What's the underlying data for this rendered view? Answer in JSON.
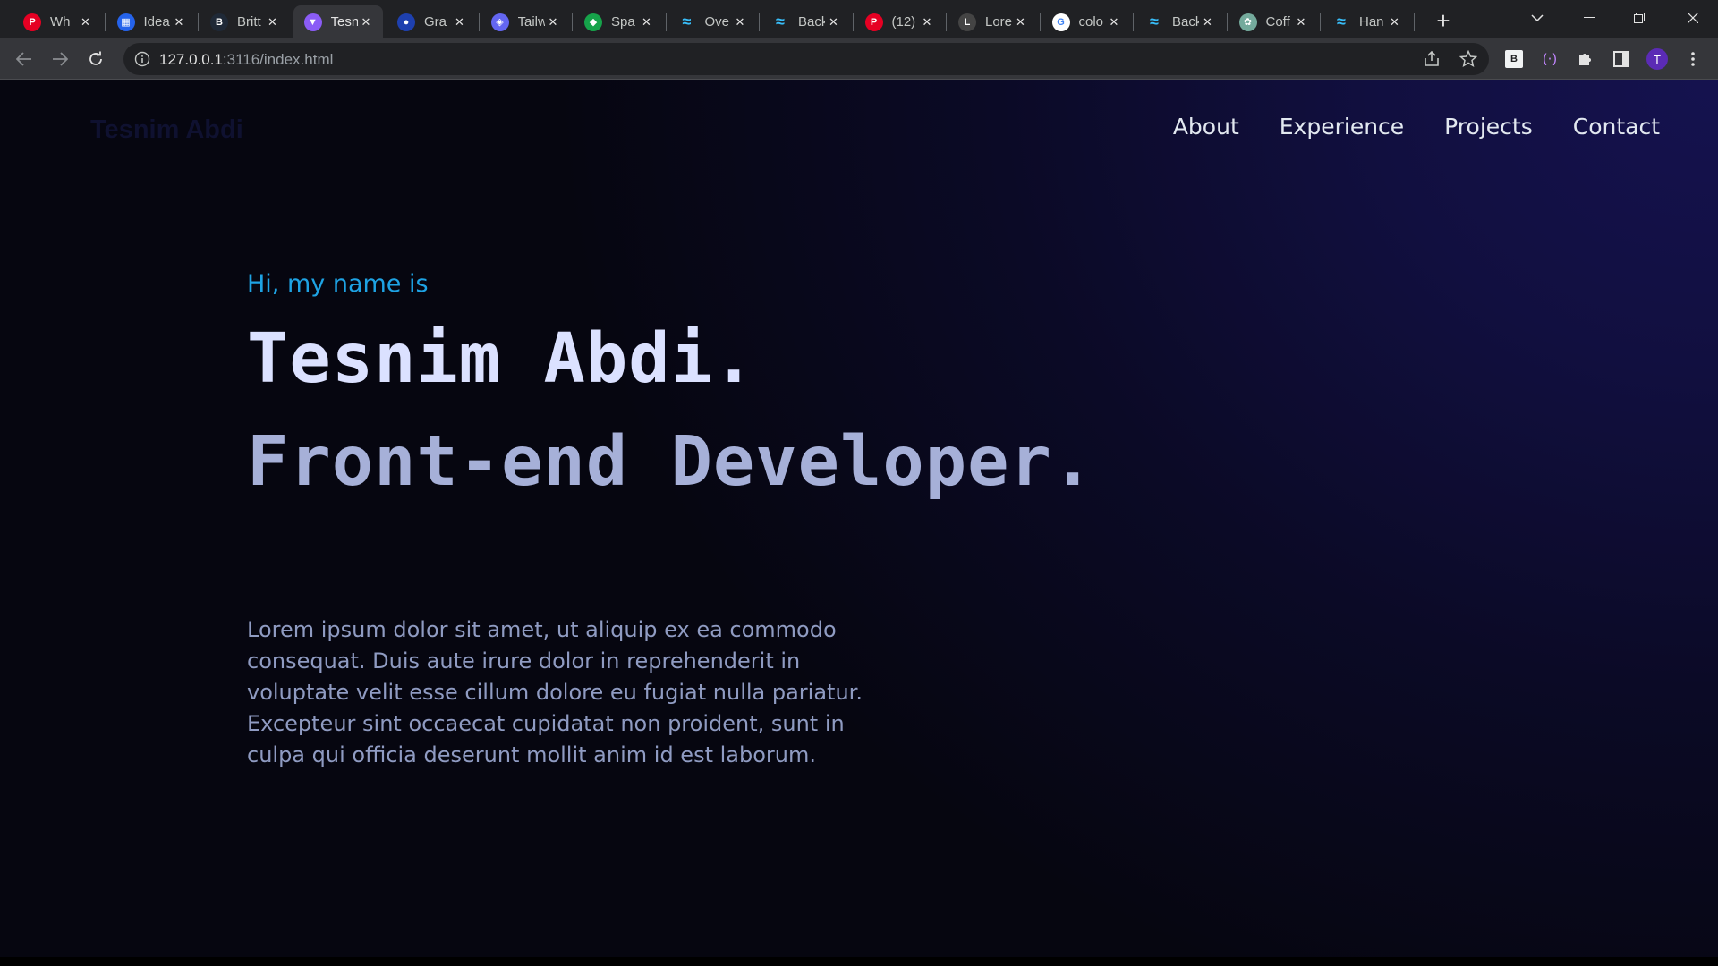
{
  "browser": {
    "tabs": [
      {
        "title": "Wh",
        "favicon": "pinterest-p-icon",
        "color": "#e60023",
        "glyph": "P"
      },
      {
        "title": "Idea",
        "favicon": "grid-icon",
        "color": "#2563eb",
        "glyph": "▦"
      },
      {
        "title": "Britt",
        "favicon": "b-icon",
        "color": "#1f2937",
        "glyph": "B"
      },
      {
        "title": "Tesn",
        "favicon": "vite-icon",
        "color": "#8b5cf6",
        "glyph": "▼",
        "active": true
      },
      {
        "title": "Gra",
        "favicon": "circle-icon",
        "color": "#1e40af",
        "glyph": "●"
      },
      {
        "title": "Tailw",
        "favicon": "headless-icon",
        "color": "#6366f1",
        "glyph": "◈"
      },
      {
        "title": "Spa",
        "favicon": "gradient-icon",
        "color": "#16a34a",
        "glyph": "◆"
      },
      {
        "title": "Ove",
        "favicon": "tailwind-icon",
        "color": "#38bdf8",
        "glyph": "≈"
      },
      {
        "title": "Back",
        "favicon": "tailwind-icon",
        "color": "#38bdf8",
        "glyph": "≈"
      },
      {
        "title": "(12)",
        "favicon": "pinterest-icon",
        "color": "#e60023",
        "glyph": "P"
      },
      {
        "title": "Lore",
        "favicon": "lorem-icon",
        "color": "#444",
        "glyph": "L"
      },
      {
        "title": "colo",
        "favicon": "google-icon",
        "color": "#ffffff",
        "glyph": "G"
      },
      {
        "title": "Back",
        "favicon": "tailwind-icon",
        "color": "#38bdf8",
        "glyph": "≈"
      },
      {
        "title": "Coff",
        "favicon": "openai-icon",
        "color": "#74aa9c",
        "glyph": "✿"
      },
      {
        "title": "Han",
        "favicon": "tailwind-icon",
        "color": "#38bdf8",
        "glyph": "≈"
      }
    ],
    "url_host": "127.0.0.1",
    "url_rest": ":3116/index.html",
    "profile_initial": "T"
  },
  "page": {
    "brand": "Tesnim Abdi",
    "nav": [
      "About",
      "Experience",
      "Projects",
      "Contact"
    ],
    "greeting": "Hi, my name is",
    "name": "Tesnim Abdi.",
    "role": "Front-end Developer.",
    "bio": "Lorem ipsum dolor sit amet, ut aliquip ex ea commodo consequat. Duis aute irure dolor in reprehenderit in voluptate velit esse cillum dolore eu fugiat nulla pariatur. Excepteur sint occaecat cupidatat non proident, sunt in culpa qui officia deserunt mollit anim id est laborum."
  },
  "colors": {
    "accent": "#1ea3e4",
    "name": "#dbe1ff",
    "role": "#a6b0d8",
    "body": "#8f9bc2"
  }
}
